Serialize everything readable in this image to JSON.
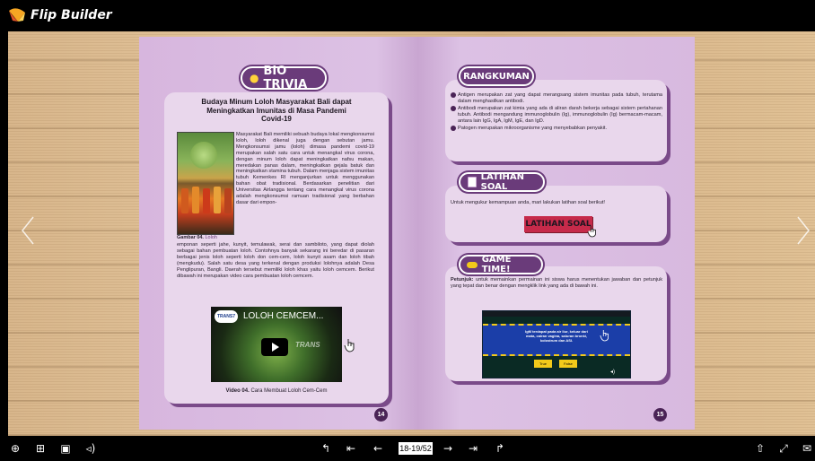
{
  "app": {
    "title": "Flip Builder"
  },
  "left_page": {
    "section_title": "BIO TRIVIA",
    "article_title": "Budaya Minum Loloh Masyarakat Bali dapat Meningkatkan Imunitas di Masa Pandemi Covid-19",
    "body_top": "Masyarakat Bali memiliki sebuah budaya lokal mengkonsumsi loloh, loloh dikenal juga dengan sebutan jamu. Mengkonsumsi jamu (loloh) dimasa pandemi covid-19 merupakan salah satu cara untuk menangkal virus corona, dengan minum loloh dapat meningkatkan nafsu makan, meredakan panas dalam, meningkatkan gejala batuk dan meningkatkan stamina tubuh. Dalam menjaga sistem imunitas tubuh Kemenkes RI menganjurkan untuk menggunakan bahan obat tradisional. Berdasarkan penelitian dari Universitas Airlangga tentang cara menangkal virus corona adalah mengkonsumsi ramuan tradisional yang berbahan dasar dari empon-",
    "body_bottom": "emponan seperti jahe, kunyit, temulawak, serai dan sambiloto, yang dapat diolah sebagai bahan pembuatan loloh. Contohnya banyak sekarang ini beredar di pasaran berbagai jenis loloh seperti loloh don cem-cem, loloh kunyit asam dan loloh tibah (mengkudu). Salah satu desa yang terkenal dengan produksi lolohnya adalah Desa Penglipuran, Bangli. Daerah tersebut memiliki loloh khas yaitu loloh cemcem. Berikut dibawah ini merupakan video cara pembuatan loloh cemcem.",
    "image_caption_label": "Gambar 04.",
    "image_caption_text": "Loloh",
    "video_channel": "TRANS7",
    "video_title": "LOLOH CEMCEM...",
    "video_watermark": "TRANS",
    "video_caption_label": "Video 04.",
    "video_caption_text": "Cara Membuat Loloh Cem-Cem",
    "page_number": "14"
  },
  "right_page": {
    "summary_title": "RANGKUMAN",
    "summary_items": [
      "Antigen merupakan zat yang dapat merangsang sistem imunitas pada tubuh, terutama dalam menghasilkan antibodi.",
      "Antibodi merupakan zat kimia yang ada di aliran darah bekerja sebagai sistem pertahanan tubuh. Antibodi mengandung immunoglobulin (Ig), immunoglobulin (Ig) bermacam-macam, antara lain IgG, IgA, IgM, IgE, dan IgD.",
      "Patogen merupakan mikroorganisme yang menyebabkan penyakit."
    ],
    "quiz_title": "LATIHAN SOAL",
    "quiz_text": "Untuk mengukur kemampuan anda, mari lakukan latihan soal berikut!",
    "quiz_button": "LATIHAN SOAL",
    "game_title": "GAME TIME!",
    "game_label": "Petunjuk:",
    "game_text": "untuk memainkan permainan ini siswa harus menentukan jawaban dan petunjuk yang tepat dan benar dengan mengklik link yang ada di bawah ini.",
    "game_preview_text": "IgM terdapat pada air liur, keluar dari mata, cairan vagina, saluran bronki, kolostrum dan ASI.",
    "game_btn_true": "True",
    "game_btn_false": "False",
    "page_number": "15"
  },
  "toolbar": {
    "page_indicator": "18-19/52"
  },
  "colors": {
    "accent": "#6a3b7a",
    "quiz_button": "#c62a4a",
    "page_bg": "#d9bbe0",
    "wood": "#dcbd93"
  }
}
